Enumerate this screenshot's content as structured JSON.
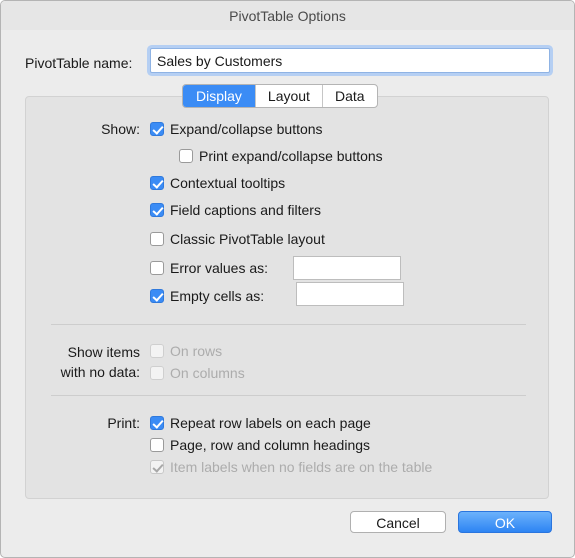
{
  "window": {
    "title": "PivotTable Options"
  },
  "name": {
    "label": "PivotTable name:",
    "value": "Sales by Customers"
  },
  "tabs": [
    {
      "label": "Display",
      "active": true
    },
    {
      "label": "Layout",
      "active": false
    },
    {
      "label": "Data",
      "active": false
    }
  ],
  "show": {
    "label": "Show:",
    "expand_collapse": {
      "label": "Expand/collapse buttons",
      "checked": true
    },
    "print_expand_collapse": {
      "label": "Print expand/collapse buttons",
      "checked": false
    },
    "contextual_tooltips": {
      "label": "Contextual tooltips",
      "checked": true
    },
    "field_captions": {
      "label": "Field captions and filters",
      "checked": true
    },
    "classic_layout": {
      "label": "Classic PivotTable layout",
      "checked": false
    },
    "error_values": {
      "label": "Error values as:",
      "checked": false,
      "value": ""
    },
    "empty_cells": {
      "label": "Empty cells as:",
      "checked": true,
      "value": ""
    }
  },
  "no_data": {
    "label_line1": "Show items",
    "label_line2": "with no data:",
    "on_rows": {
      "label": "On rows",
      "checked": false,
      "disabled": true
    },
    "on_columns": {
      "label": "On columns",
      "checked": false,
      "disabled": true
    }
  },
  "print": {
    "label": "Print:",
    "repeat_row_labels": {
      "label": "Repeat row labels on each page",
      "checked": true
    },
    "headings": {
      "label": "Page, row and column headings",
      "checked": false
    },
    "item_labels": {
      "label": "Item labels when no fields are on the table",
      "checked": true,
      "disabled": true
    }
  },
  "buttons": {
    "cancel": "Cancel",
    "ok": "OK"
  },
  "colors": {
    "accent": "#3b8cf5",
    "panel": "#e3e3e3",
    "window": "#ececec"
  }
}
